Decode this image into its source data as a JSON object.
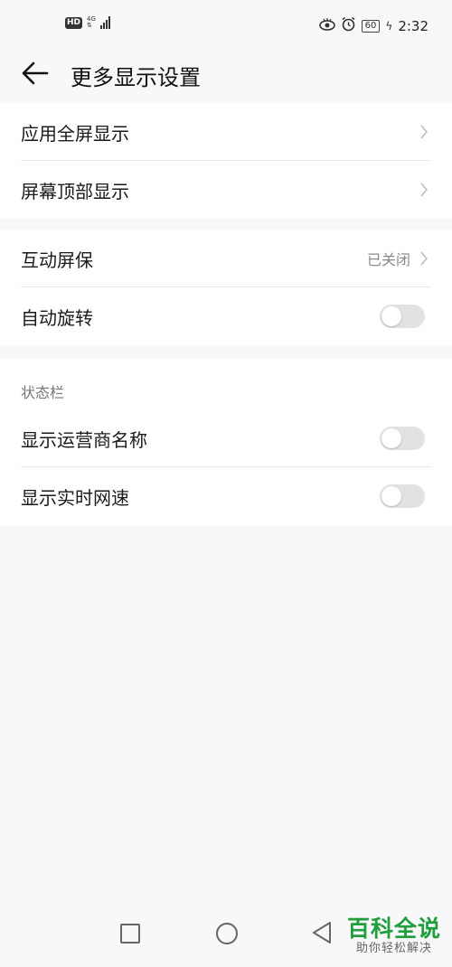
{
  "status_bar": {
    "hd_label": "HD",
    "network_type": "4G",
    "battery_level": "60",
    "time": "2:32",
    "icons": [
      "eye-comfort-icon",
      "alarm-icon",
      "battery-icon",
      "charging-icon",
      "signal-icon"
    ]
  },
  "header": {
    "title": "更多显示设置",
    "back_icon": "arrow-left-icon"
  },
  "group1": {
    "items": [
      {
        "label": "应用全屏显示"
      },
      {
        "label": "屏幕顶部显示"
      }
    ]
  },
  "group2": {
    "items": [
      {
        "label": "互动屏保",
        "value": "已关闭"
      },
      {
        "label": "自动旋转",
        "toggle": false
      }
    ]
  },
  "group3": {
    "section_title": "状态栏",
    "items": [
      {
        "label": "显示运营商名称",
        "toggle": false
      },
      {
        "label": "显示实时网速",
        "toggle": false
      }
    ]
  },
  "nav_bar": {
    "icons": [
      "recent-apps-icon",
      "home-icon",
      "back-icon"
    ]
  },
  "watermark": {
    "main": "百科全说",
    "sub": "助你轻松解决"
  },
  "colors": {
    "background": "#f8f7fa",
    "card": "#ffffff",
    "toggle_off": "#e2e2e2",
    "watermark_green": "#1f9e3b"
  }
}
